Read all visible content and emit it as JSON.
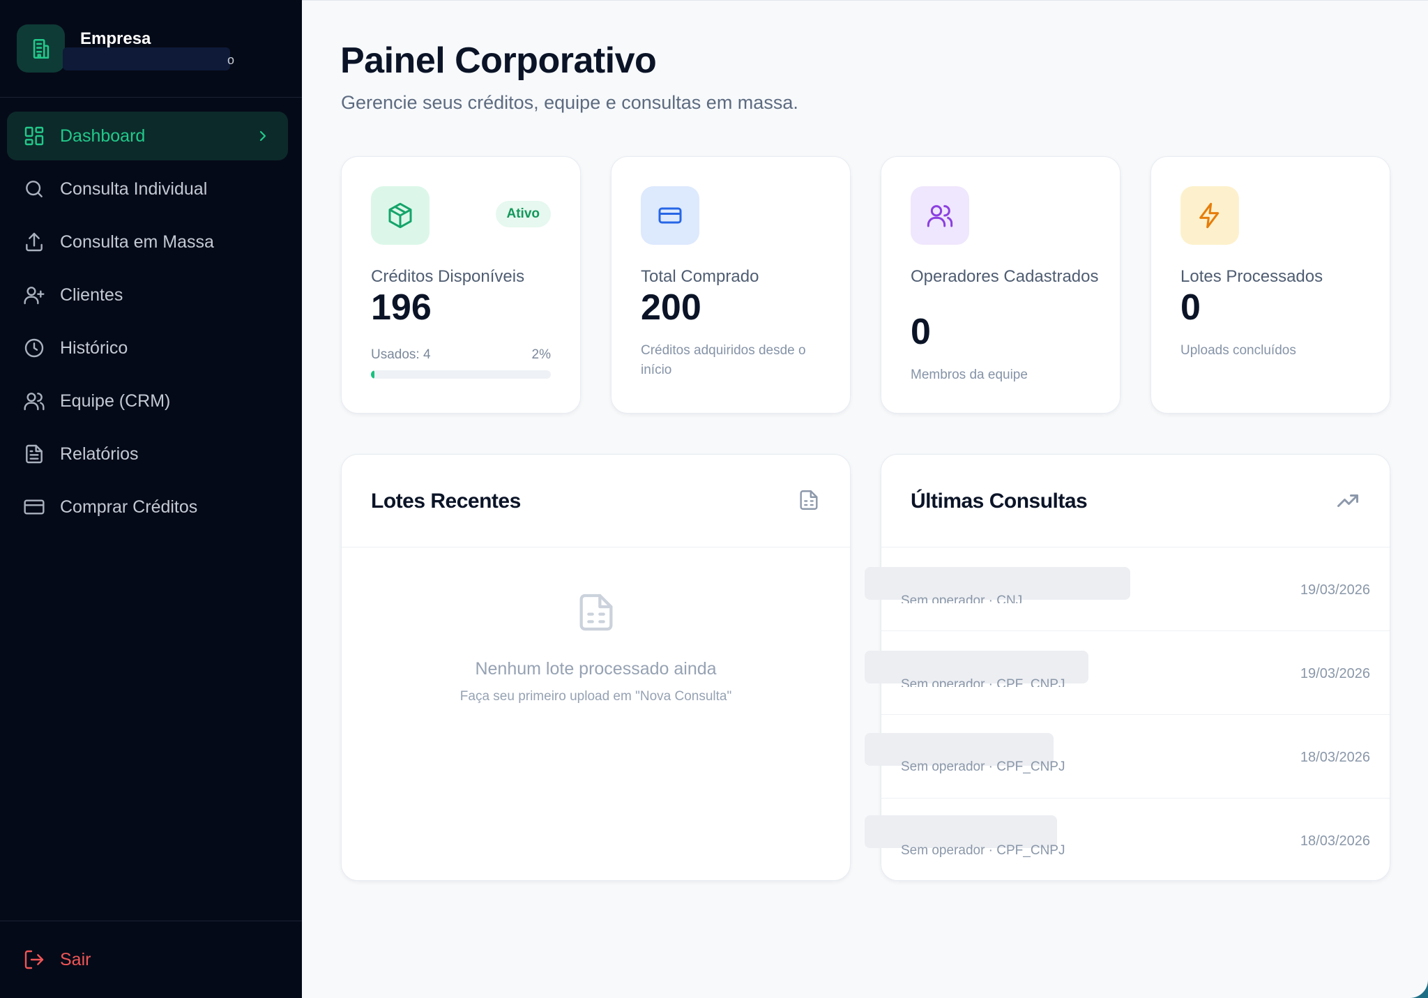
{
  "brand": {
    "name": "Empresa",
    "subtitle_tail": "o"
  },
  "nav": [
    {
      "label": "Dashboard",
      "icon": "layout-grid-icon",
      "active": true
    },
    {
      "label": "Consulta Individual",
      "icon": "search-icon"
    },
    {
      "label": "Consulta em Massa",
      "icon": "upload-icon"
    },
    {
      "label": "Clientes",
      "icon": "user-plus-icon"
    },
    {
      "label": "Histórico",
      "icon": "clock-icon"
    },
    {
      "label": "Equipe (CRM)",
      "icon": "users-icon"
    },
    {
      "label": "Relatórios",
      "icon": "file-text-icon"
    },
    {
      "label": "Comprar Créditos",
      "icon": "credit-card-icon"
    }
  ],
  "logout": {
    "label": "Sair"
  },
  "page": {
    "title": "Painel Corporativo",
    "subtitle": "Gerencie seus créditos, equipe e consultas em massa."
  },
  "stats": {
    "credits": {
      "label": "Créditos Disponíveis",
      "value": "196",
      "badge": "Ativo",
      "used_label": "Usados: 4",
      "used_pct_label": "2%",
      "used_fraction": 0.02
    },
    "total": {
      "label": "Total Comprado",
      "value": "200",
      "desc": "Créditos adquiridos desde o início"
    },
    "operators": {
      "label": "Operadores Cadastrados",
      "value": "0",
      "desc": "Membros da equipe"
    },
    "batches": {
      "label": "Lotes Processados",
      "value": "0",
      "desc": "Uploads concluídos"
    }
  },
  "recent_batches": {
    "title": "Lotes Recentes",
    "empty_title": "Nenhum lote processado ainda",
    "empty_sub": "Faça seu primeiro upload em \"Nova Consulta\""
  },
  "last_queries": {
    "title": "Últimas Consultas",
    "rows": [
      {
        "sub": "Sem operador · CNJ",
        "date": "19/03/2026"
      },
      {
        "sub": "Sem operador · CPF_CNPJ",
        "date": "19/03/2026"
      },
      {
        "sub": "Sem operador · CPF_CNPJ",
        "date": "18/03/2026"
      },
      {
        "sub": "Sem operador · CPF_CNPJ",
        "date": "18/03/2026"
      }
    ]
  },
  "colors": {
    "accent": "#22c98a",
    "sidebar": "#050a18",
    "danger": "#f05656"
  }
}
